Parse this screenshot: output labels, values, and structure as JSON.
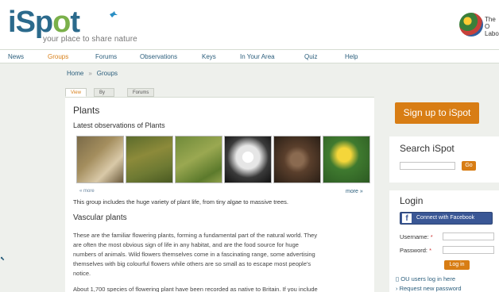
{
  "header": {
    "logo": {
      "i": "i",
      "s": "S",
      "p": "p",
      "o": "o",
      "t": "t"
    },
    "tagline": "your place to share nature",
    "ou_text_line1": "The O",
    "ou_text_line2": "Labo"
  },
  "nav": {
    "items": [
      "News",
      "Groups",
      "Forums",
      "Observations",
      "Keys",
      "In Your Area",
      "Quiz",
      "Help"
    ],
    "active": "Groups"
  },
  "breadcrumb": {
    "home": "Home",
    "sep": "»",
    "current": "Groups"
  },
  "tabs": [
    "View",
    "By term",
    "Forums"
  ],
  "main": {
    "title": "Plants",
    "latest_heading": "Latest observations of Plants",
    "more_left": "« more",
    "more_right": "more »",
    "intro": "This group includes the huge variety of plant life, from tiny algae to massive trees.",
    "section_title": "Vascular plants",
    "para1_line1": "These are the familiar flowering plants, forming a fundamental part of the natural world. They",
    "para1_line2": "are often the most obvious sign of life in any habitat, and are the food source for huge",
    "para1_line3": "numbers of animals. Wild flowers themselves come in a fascinating range, some advertising",
    "para1_line4": "themselves with big colourful flowers while others are so small as to escape most people's",
    "para1_line5": "notice.",
    "para2_line1": "About 1,700 species of flowering plant have been recorded as native to Britain. If you include"
  },
  "sidebar": {
    "signup": "Sign up to iSpot",
    "search_title": "Search iSpot",
    "go": "Go",
    "login_title": "Login",
    "facebook": "Connect with Facebook",
    "username": "Username:",
    "password": "Password:",
    "required": "*",
    "login_btn": "Log in",
    "ou_login": "OU users log in here",
    "request_pw": "Request new password"
  }
}
